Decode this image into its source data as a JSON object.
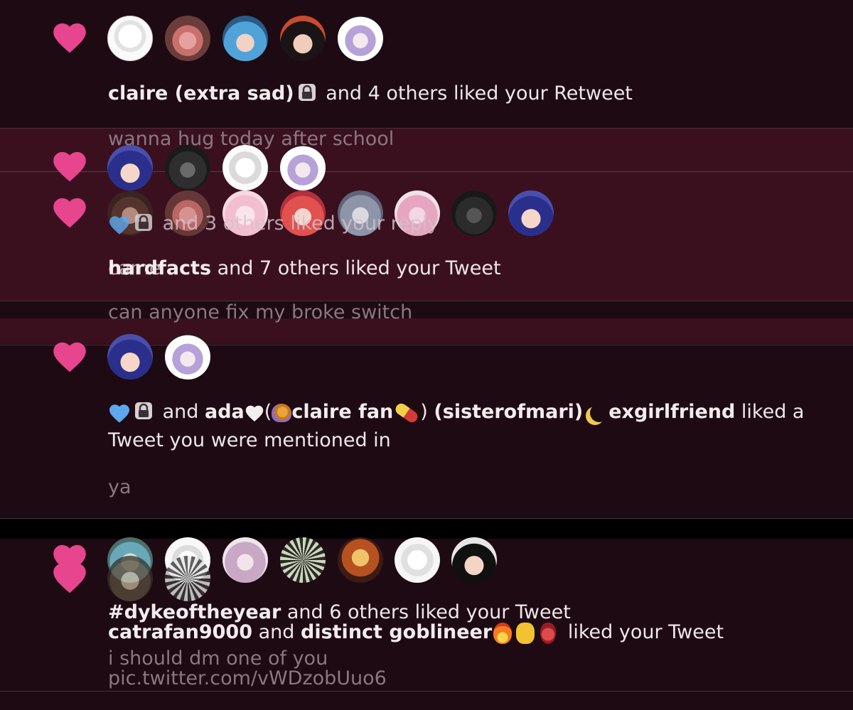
{
  "colors": {
    "background": "#1e0a12",
    "row_highlight": "#3a101f",
    "heart": "#e8458f",
    "text": "#efe6ea",
    "muted": "#8c767f"
  },
  "icons": {
    "like": "heart-icon",
    "lock": "lock-icon",
    "blue_heart": "blue-heart-emoji",
    "snail": "snail-emoji",
    "pill": "pill-emoji",
    "moon": "crescent-moon-emoji",
    "fire": "fire-emoji",
    "ok_hand": "pinch-hand-emoji",
    "anatomical_heart": "anatomical-heart-emoji"
  },
  "n1": {
    "actor": "claire (extra sad)",
    "rest": "and 4 others liked your Retweet"
  },
  "n2": {
    "tweet": "wanna hug today after school",
    "text": "and 3 others liked your reply",
    "subtext": "came"
  },
  "n3": {
    "actor": "hardfacts",
    "rest": "and 7 others liked your Tweet",
    "tweet": "can anyone fix my broke switch"
  },
  "n4": {
    "and_word": "and",
    "actor_a": "ada",
    "actor_b": "claire fan",
    "actor_c": "(sisterofmari)",
    "actor_d": "exgirlfriend",
    "rest_line1": "liked a",
    "rest_line2": "Tweet you were mentioned in",
    "tweet": "ya"
  },
  "n5": {
    "actor": "#dykeoftheyear",
    "rest": "and 6 others liked your Tweet",
    "tweet": "i should dm one of you"
  },
  "n6": {
    "actor_a": "catrafan9000",
    "and_word": "and",
    "actor_b": "distinct goblineer",
    "rest": "liked your Tweet",
    "tweet": "pic.twitter.com/vWDzobUuo6"
  }
}
